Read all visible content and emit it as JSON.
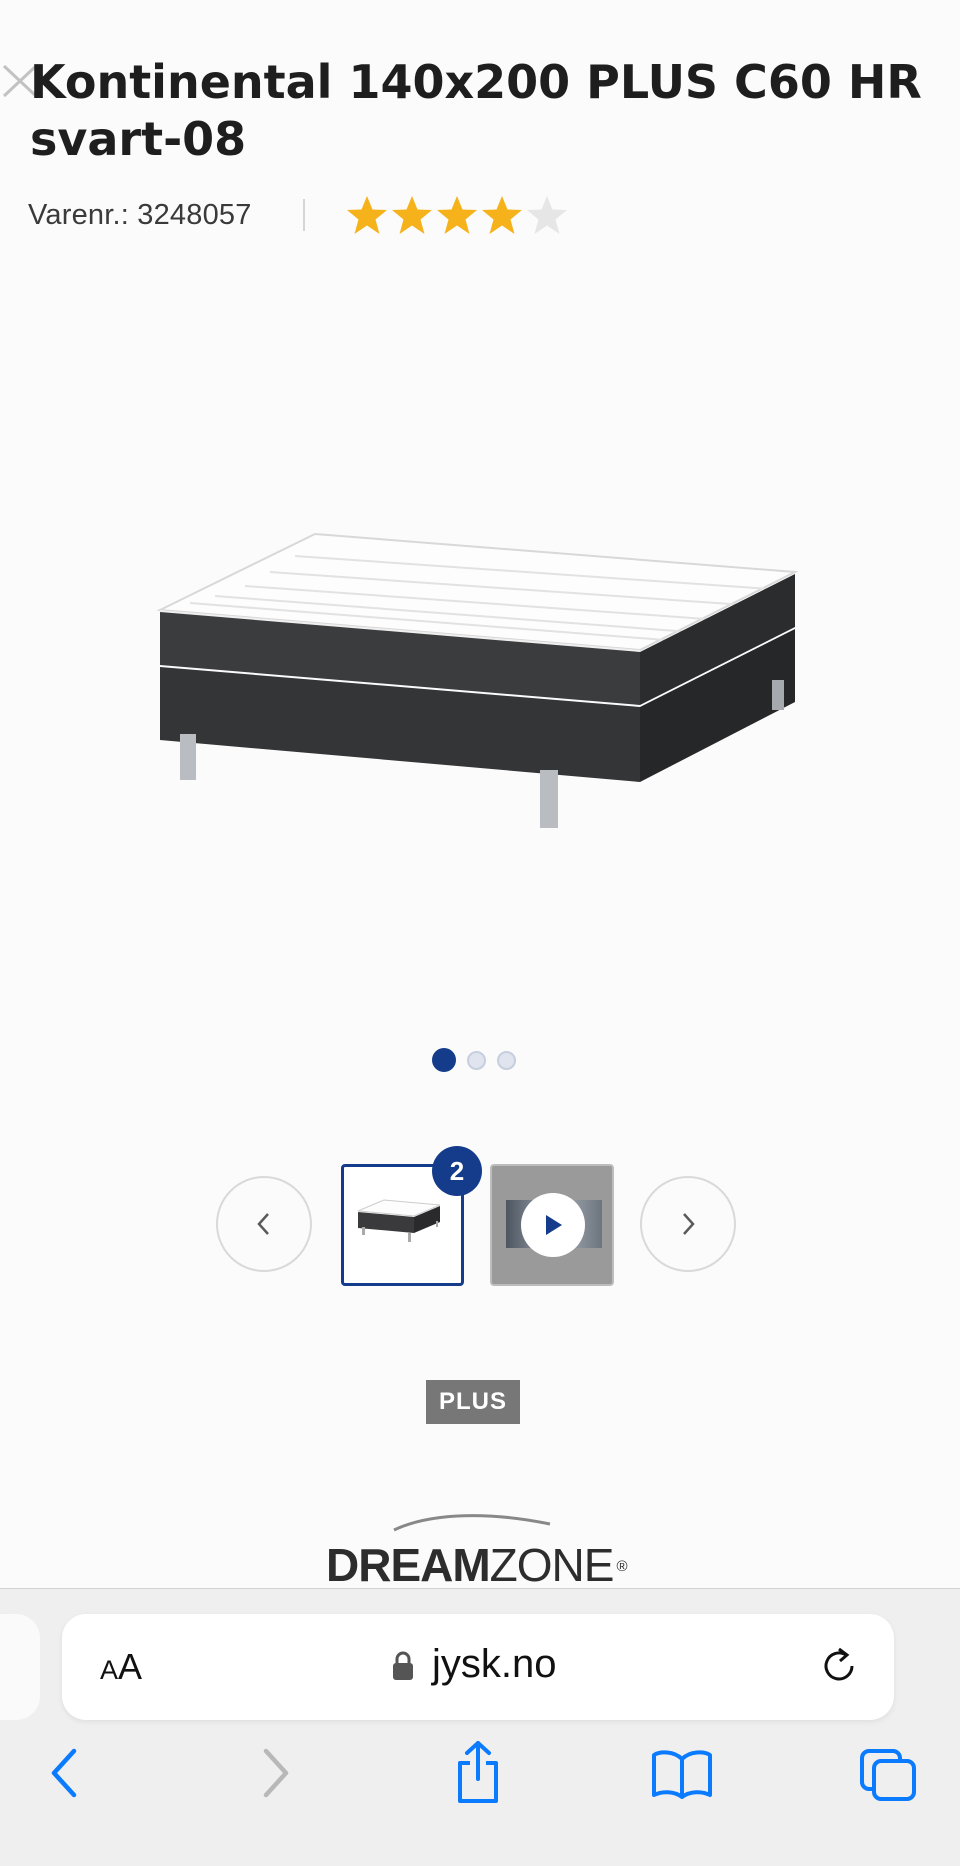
{
  "product": {
    "title": "Kontinental 140x200 PLUS C60 HR svart-08",
    "sku_label": "Varenr.: 3248057",
    "rating": {
      "value": 4,
      "max": 5
    }
  },
  "gallery": {
    "slide_count": 3,
    "active_slide": 1,
    "thumbnail_badge": "2",
    "thumbnail_types": [
      "image",
      "video"
    ]
  },
  "tags": {
    "series": "PLUS"
  },
  "brand": {
    "name_bold": "DREAM",
    "name_regular": "ZONE",
    "mark": "®"
  },
  "browser": {
    "text_size_label_small": "A",
    "text_size_label_large": "A",
    "url": "jysk.no"
  },
  "colors": {
    "accent": "#143c8a",
    "star_filled": "#f5b21a",
    "star_empty": "#e6e6e6",
    "ios_blue": "#0a7aff"
  },
  "icons": [
    "close-icon",
    "star-icon",
    "chevron-left-icon",
    "chevron-right-icon",
    "play-icon",
    "lock-icon",
    "reload-icon",
    "back-icon",
    "forward-icon",
    "share-icon",
    "bookmarks-icon",
    "tabs-icon"
  ]
}
